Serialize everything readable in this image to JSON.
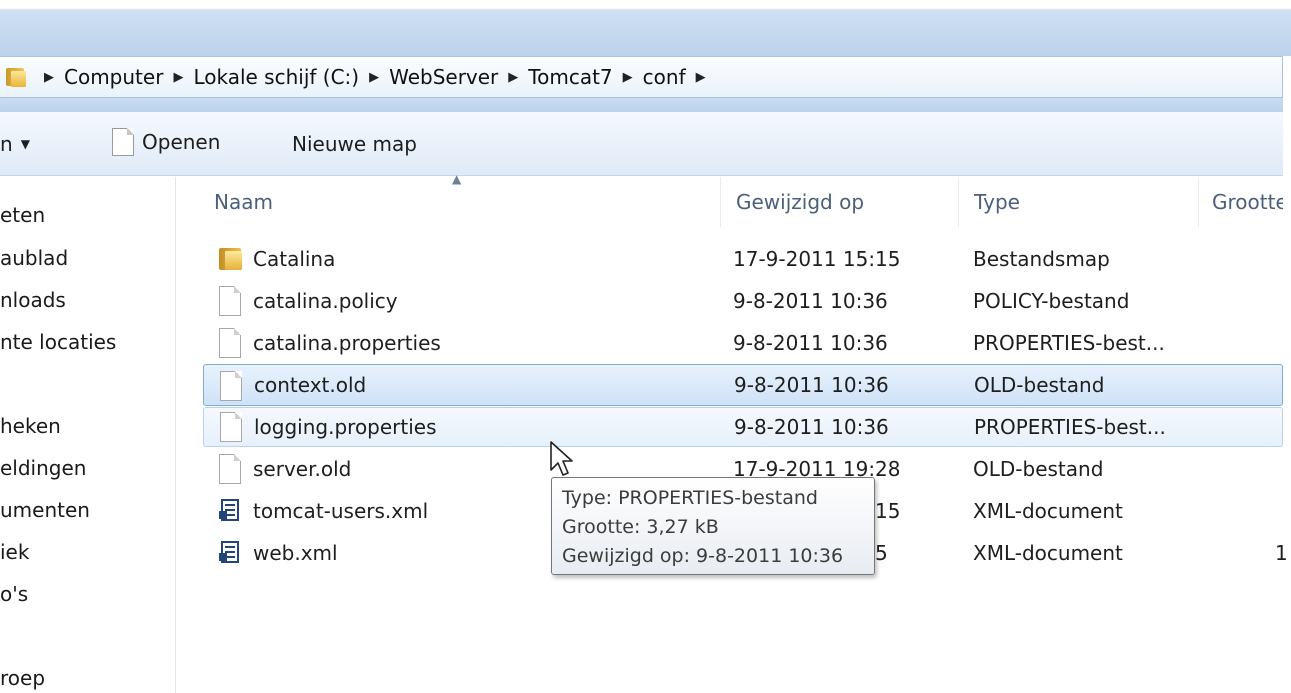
{
  "breadcrumb": {
    "items": [
      "Computer",
      "Lokale schijf (C:)",
      "WebServer",
      "Tomcat7",
      "conf"
    ]
  },
  "toolbar": {
    "organize_label": "n",
    "open_label": "Openen",
    "new_folder_label": "Nieuwe map"
  },
  "nav": {
    "items": [
      "eten",
      "aublad",
      "nloads",
      "nte locaties",
      "heken",
      "eldingen",
      "umenten",
      "iek",
      "o's",
      "roep"
    ]
  },
  "columns": {
    "name": "Naam",
    "modified": "Gewijzigd op",
    "type": "Type",
    "size": "Grootte"
  },
  "files": [
    {
      "name": "Catalina",
      "modified": "17-9-2011 15:15",
      "type": "Bestandsmap",
      "icon": "folder-icon"
    },
    {
      "name": "catalina.policy",
      "modified": "9-8-2011 10:36",
      "type": "POLICY-bestand",
      "icon": "file-icon"
    },
    {
      "name": "catalina.properties",
      "modified": "9-8-2011 10:36",
      "type": "PROPERTIES-best...",
      "icon": "file-icon"
    },
    {
      "name": "context.old",
      "modified": "9-8-2011 10:36",
      "type": "OLD-bestand",
      "icon": "file-icon"
    },
    {
      "name": "logging.properties",
      "modified": "9-8-2011 10:36",
      "type": "PROPERTIES-best...",
      "icon": "file-icon"
    },
    {
      "name": "server.old",
      "modified": "17-9-2011 19:28",
      "type": "OLD-bestand",
      "icon": "file-icon"
    },
    {
      "name": "tomcat-users.xml",
      "modified": "15",
      "type": "XML-document",
      "icon": "xml-icon"
    },
    {
      "name": "web.xml",
      "modified": "5",
      "type": "XML-document",
      "icon": "xml-icon",
      "size_partial": "1"
    }
  ],
  "tooltip": {
    "type_line": "Type: PROPERTIES-bestand",
    "size_line": "Grootte: 3,27 kB",
    "modified_line": "Gewijzigd op: 9-8-2011 10:36"
  },
  "colors": {
    "selection_border": "#83a9d3",
    "selection_fill": "#cfe2f7",
    "address_bar": "#eaf2fb"
  }
}
